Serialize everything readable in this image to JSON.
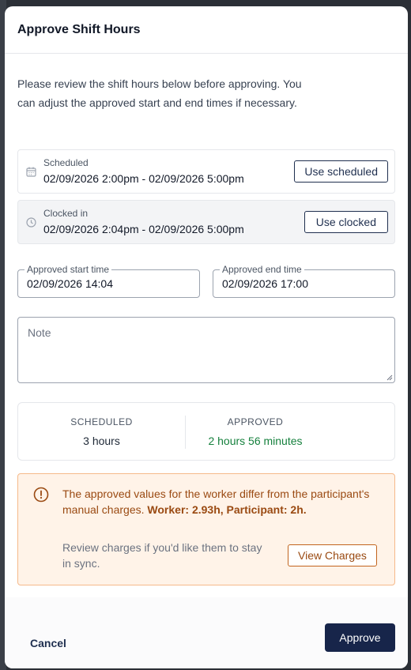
{
  "modal": {
    "title": "Approve Shift Hours",
    "intro": "Please review the shift hours below before approving. You can adjust the approved start and end times if necessary."
  },
  "scheduled": {
    "label": "Scheduled",
    "range": "02/09/2026 2:00pm - 02/09/2026 5:00pm",
    "button": "Use scheduled",
    "icon": "calendar-icon"
  },
  "clocked": {
    "label": "Clocked in",
    "range": "02/09/2026 2:04pm - 02/09/2026 5:00pm",
    "button": "Use clocked",
    "icon": "clock-icon"
  },
  "approved_start": {
    "label": "Approved start time",
    "value": "02/09/2026 14:04"
  },
  "approved_end": {
    "label": "Approved end time",
    "value": "02/09/2026 17:00"
  },
  "note": {
    "placeholder": "Note"
  },
  "summary": {
    "scheduled_label": "SCHEDULED",
    "scheduled_value": "3 hours",
    "approved_label": "APPROVED",
    "approved_value": "2 hours 56 minutes",
    "approved_color": "#15803d"
  },
  "warning": {
    "text": "The approved values for the worker differ from the participant's manual charges.",
    "bold": "Worker: 2.93h, Participant: 2h.",
    "sub": "Review charges if you'd like them to stay in sync.",
    "button": "View Charges"
  },
  "footer": {
    "cancel": "Cancel",
    "approve": "Approve"
  },
  "colors": {
    "primary": "#17254a",
    "warning_bg": "#fff3e8",
    "warning_text": "#9a4a12"
  }
}
